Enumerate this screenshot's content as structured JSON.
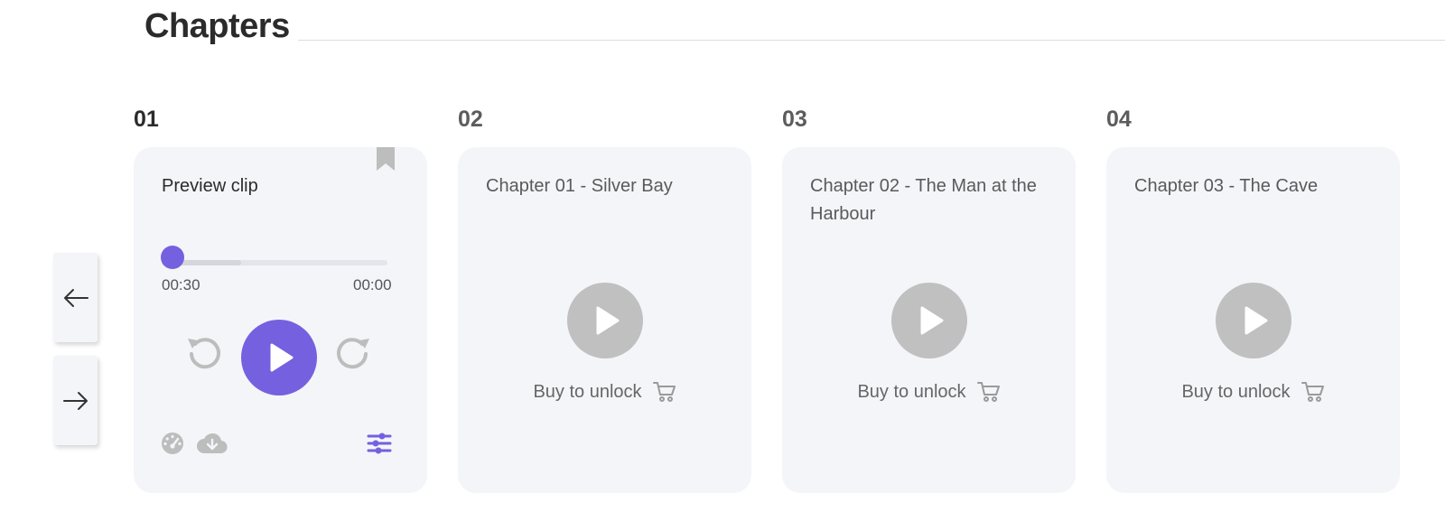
{
  "section": {
    "title": "Chapters"
  },
  "nav": {
    "prev_icon": "arrow-left-icon",
    "next_icon": "arrow-right-icon"
  },
  "theme": {
    "accent": "#7560e0",
    "locked_play": "#c0c0c0",
    "card_bg": "#f4f5f9"
  },
  "chapters": [
    {
      "number": "01",
      "title": "Preview clip",
      "unlocked": true,
      "player": {
        "elapsed": "00:30",
        "remaining": "00:00",
        "progress": 0.0,
        "buffered": 0.35
      },
      "icons": [
        "bookmark-icon",
        "rewind-icon",
        "play-icon",
        "forward-icon",
        "speed-icon",
        "cloud-download-icon",
        "settings-sliders-icon"
      ]
    },
    {
      "number": "02",
      "title": "Chapter 01 - Silver Bay",
      "unlocked": false,
      "buy_label": "Buy to unlock"
    },
    {
      "number": "03",
      "title": "Chapter 02 - The Man at the Harbour",
      "unlocked": false,
      "buy_label": "Buy to unlock"
    },
    {
      "number": "04",
      "title": "Chapter 03 - The Cave",
      "unlocked": false,
      "buy_label": "Buy to unlock"
    }
  ]
}
